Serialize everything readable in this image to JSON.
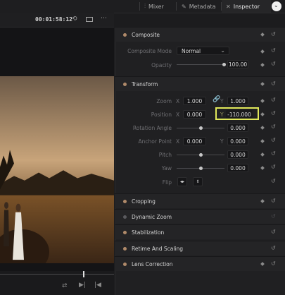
{
  "tabs": [
    {
      "label": "Mixer",
      "icon": "mixer-icon"
    },
    {
      "label": "Metadata",
      "icon": "metadata-icon"
    },
    {
      "label": "Inspector",
      "icon": "inspector-icon"
    }
  ],
  "viewer": {
    "timecode": "00:01:58:12"
  },
  "inspector": {
    "composite": {
      "title": "Composite",
      "mode_label": "Composite Mode",
      "mode_value": "Normal",
      "opacity_label": "Opacity",
      "opacity_value": "100.00",
      "opacity_level": 1.0
    },
    "transform": {
      "title": "Transform",
      "zoom_label": "Zoom",
      "zoom_x": "1.000",
      "zoom_y": "1.000",
      "position_label": "Position",
      "position_x": "0.000",
      "position_y": "-110.000",
      "rotation_label": "Rotation Angle",
      "rotation_value": "0.000",
      "anchor_label": "Anchor Point",
      "anchor_x": "0.000",
      "anchor_y": "0.000",
      "pitch_label": "Pitch",
      "pitch_value": "0.000",
      "yaw_label": "Yaw",
      "yaw_value": "0.000",
      "flip_label": "Flip",
      "axis_x": "X",
      "axis_y": "Y"
    },
    "sections": [
      {
        "title": "Cropping"
      },
      {
        "title": "Dynamic Zoom"
      },
      {
        "title": "Stabilization"
      },
      {
        "title": "Retime And Scaling"
      },
      {
        "title": "Lens Correction"
      }
    ]
  },
  "colors": {
    "accent": "#e0e85a",
    "section_dot": "#b08a6a"
  }
}
